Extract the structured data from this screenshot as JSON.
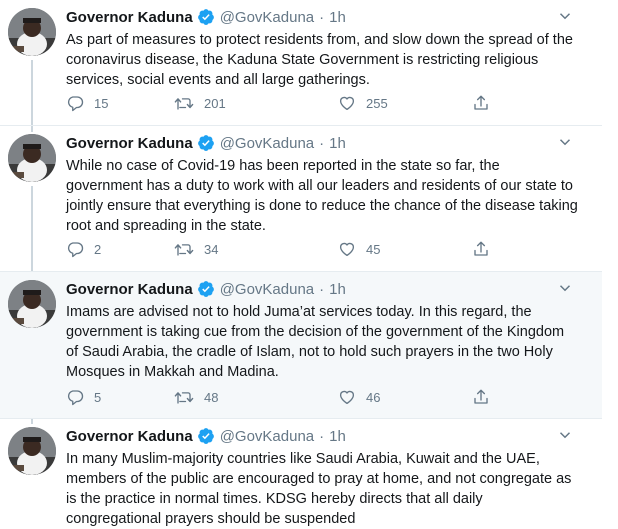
{
  "account": {
    "name": "Governor Kaduna",
    "handle": "@GovKaduna",
    "separator": "·"
  },
  "icons": {
    "avatar": "avatar-icon",
    "verified": "verified-badge-icon",
    "caret": "chevron-down-icon",
    "reply": "reply-icon",
    "retweet": "retweet-icon",
    "like": "heart-icon",
    "share": "share-icon"
  },
  "colors": {
    "verified": "#1da1f2",
    "muted": "#657786",
    "text": "#14171a",
    "hover_bg": "#f5f8fa",
    "divider": "#e6ecf0"
  },
  "tweets": [
    {
      "time": "1h",
      "text": "As part of measures to protect residents from, and slow down the spread of the coronavirus disease, the Kaduna State Government is restricting religious services, social events and all large gatherings.",
      "replies": "15",
      "retweets": "201",
      "likes": "255"
    },
    {
      "time": "1h",
      "text": "While no case of Covid-19 has been reported in the state so far, the government has a duty to work with all our leaders and residents of our state to jointly ensure that everything is done to reduce the chance of the disease taking root and spreading in the state.",
      "replies": "2",
      "retweets": "34",
      "likes": "45"
    },
    {
      "time": "1h",
      "text": "Imams are advised not to hold Juma’at services today. In this regard, the government is taking cue from the decision of the government of the Kingdom of Saudi Arabia, the cradle of Islam, not to hold such prayers in the two Holy Mosques in Makkah and Madina.",
      "replies": "5",
      "retweets": "48",
      "likes": "46"
    },
    {
      "time": "1h",
      "text": "In many Muslim-majority countries like Saudi Arabia, Kuwait and the UAE, members of the public are encouraged to pray at home, and not congregate as is the practice in normal times. KDSG hereby directs that all daily congregational prayers should be suspended"
    }
  ]
}
